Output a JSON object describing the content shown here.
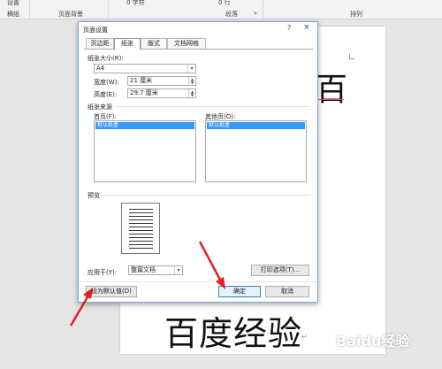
{
  "ribbon": {
    "setup_label": "设置",
    "draft_label": "稿纸",
    "page_bg_label": "页面背景",
    "paragraph_label": "段落",
    "arrange_label": "排列",
    "indent_value": "0 字符",
    "spacing_value": "0 行"
  },
  "dialog": {
    "title": "页面设置",
    "help": "?",
    "close": "×",
    "tabs": [
      "页边距",
      "纸张",
      "版式",
      "文档网格"
    ],
    "paper_size_label": "纸张大小(R):",
    "paper_size_value": "A4",
    "width_label": "宽度(W):",
    "width_value": "21 厘米",
    "height_label": "高度(E):",
    "height_value": "29.7 厘米",
    "source_label": "纸张来源",
    "first_page_label": "首页(F):",
    "first_page_selected": "默认纸盒",
    "other_pages_label": "其他页(O):",
    "other_pages_selected": "默认纸盒",
    "preview_label": "预览",
    "apply_to_label": "应用于(Y):",
    "apply_to_value": "整篇文档",
    "print_options_button": "打印选项(T)...",
    "set_default_button": "设为默认值(D)",
    "ok_button": "确定",
    "cancel_button": "取消"
  },
  "document": {
    "top_char": "百",
    "body_text": "百度经验",
    "watermark": "Baidu经验"
  }
}
